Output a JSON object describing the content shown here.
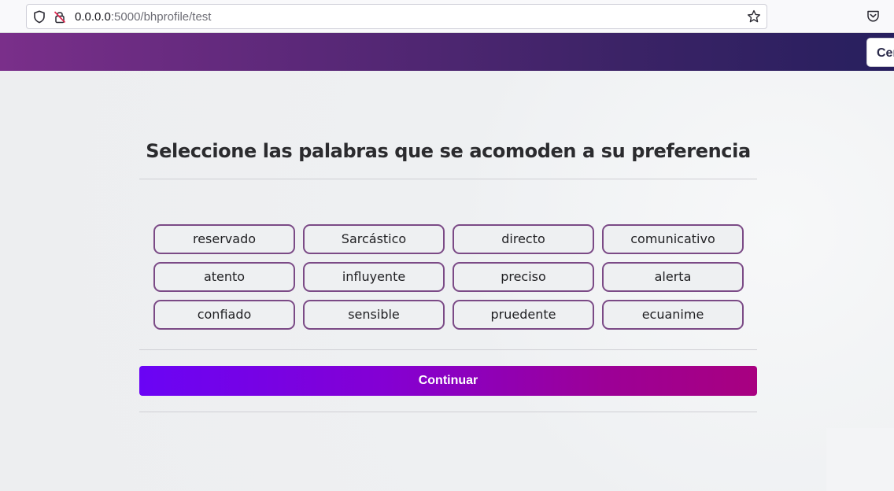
{
  "browser": {
    "url_host": "0.0.0.0",
    "url_path": ":5000/bhprofile/test"
  },
  "header": {
    "button_label": "Cer"
  },
  "test": {
    "title": "Seleccione las palabras que se acomoden a su preferencia",
    "words": [
      "reservado",
      "Sarcástico",
      "directo",
      "comunicativo",
      "atento",
      "influyente",
      "preciso",
      "alerta",
      "confiado",
      "sensible",
      "pruedente",
      "ecuanime"
    ],
    "continue_label": "Continuar"
  },
  "colors": {
    "word_border": "#7b4a86",
    "continue_start": "#6a04f5",
    "continue_end": "#a80080",
    "header_start": "#7a2f8a",
    "header_end": "#271f5e"
  }
}
